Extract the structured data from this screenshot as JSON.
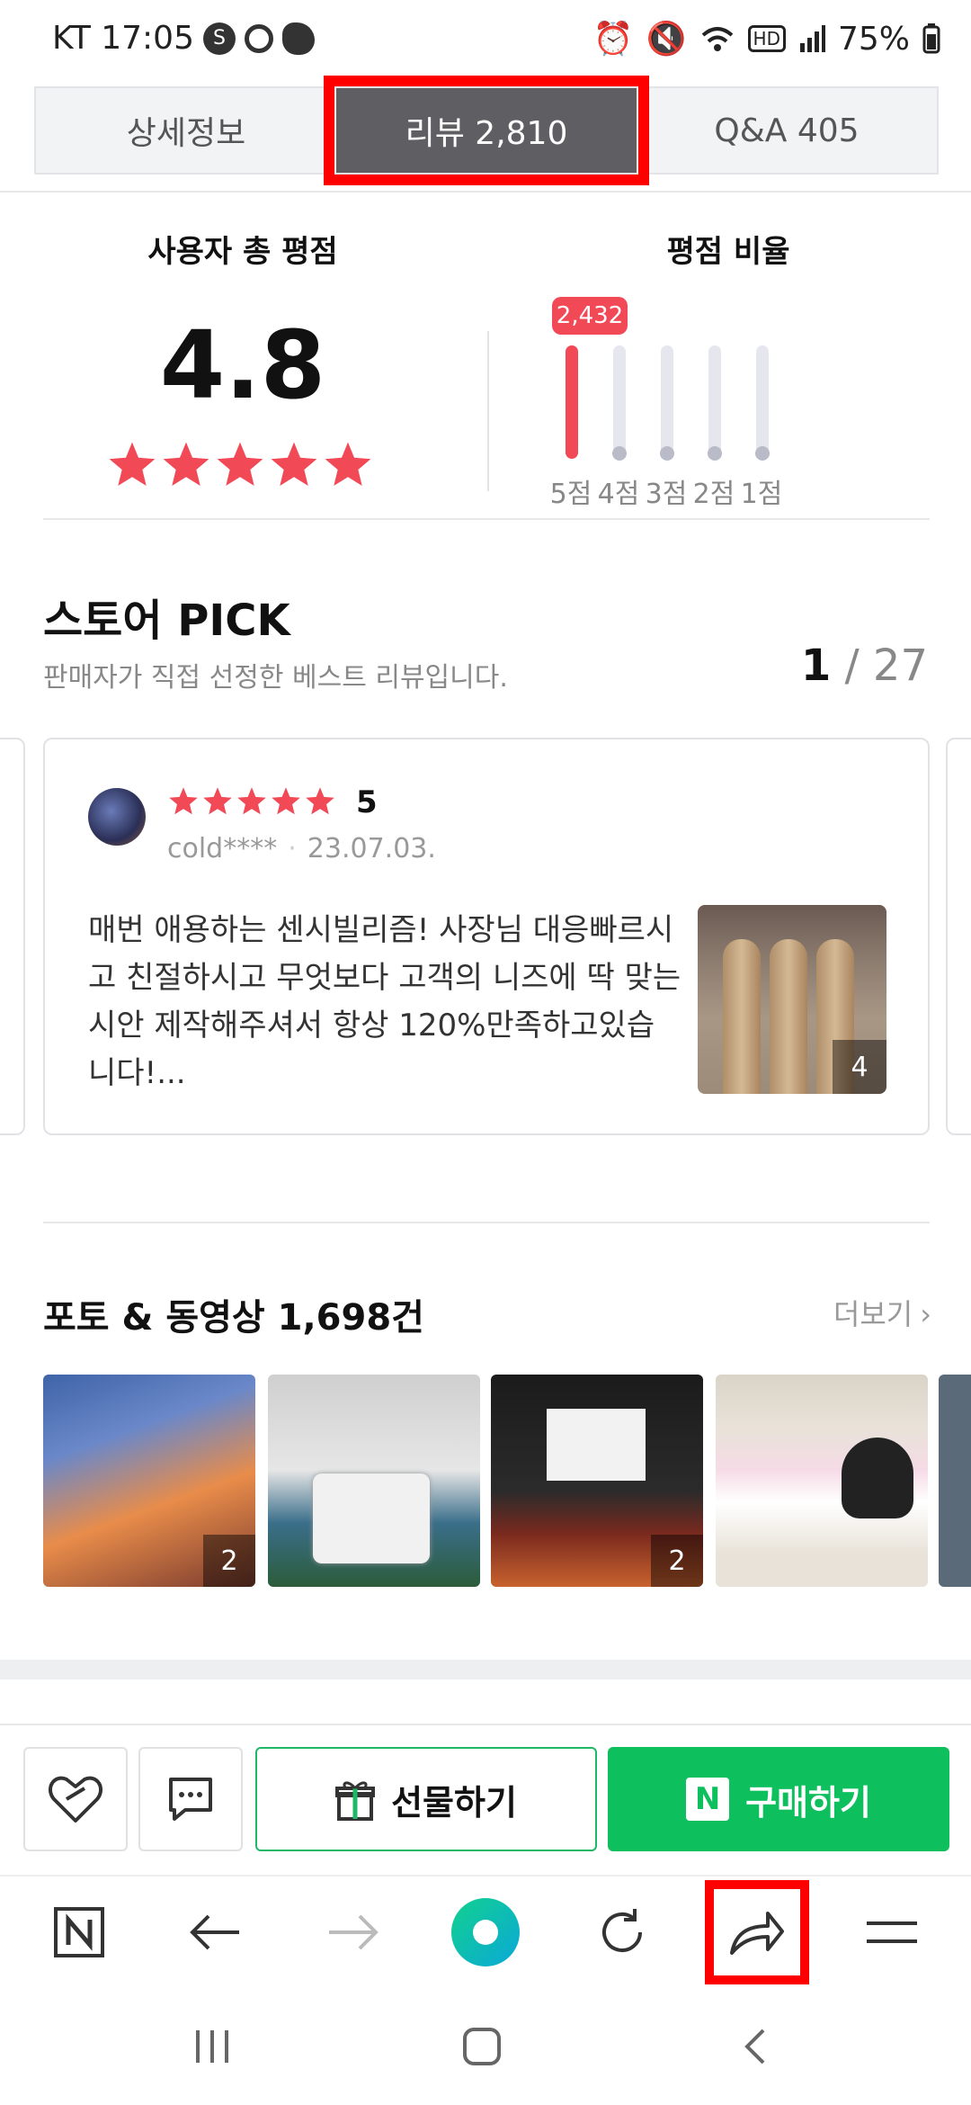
{
  "status_bar": {
    "carrier_time": "KT 17:05",
    "battery": "75%"
  },
  "tabs": [
    {
      "label": "상세정보"
    },
    {
      "label": "리뷰  2,810"
    },
    {
      "label": "Q&A  405"
    }
  ],
  "summary": {
    "total_title": "사용자 총 평점",
    "score": "4.8",
    "ratio_title": "평점 비율",
    "top_count": "2,432",
    "bars": [
      {
        "label": "5점",
        "fraction": 1.0
      },
      {
        "label": "4점",
        "fraction": 0.0
      },
      {
        "label": "3점",
        "fraction": 0.0
      },
      {
        "label": "2점",
        "fraction": 0.0
      },
      {
        "label": "1점",
        "fraction": 0.0
      }
    ]
  },
  "store_pick": {
    "title": "스토어 PICK",
    "subtitle": "판매자가 직접 선정한 베스트 리뷰입니다.",
    "page_current": "1",
    "page_sep": " / ",
    "page_total": "27",
    "review": {
      "score": "5",
      "user": "cold****",
      "date": "23.07.03.",
      "text": "매번 애용하는 센시빌리즘! 사장님 대응빠르시고 친절하시고 무엇보다 고객의 니즈에 딱 맞는 시안 제작해주셔서 항상 120%만족하고있습니다!...",
      "photo_count": "4"
    }
  },
  "photos": {
    "title": "포토 & 동영상 1,698건",
    "more": "더보기",
    "items": [
      {
        "count": "2"
      },
      {
        "count": ""
      },
      {
        "count": "2"
      },
      {
        "count": ""
      }
    ]
  },
  "actions": {
    "gift": "선물하기",
    "buy": "구매하기",
    "n_badge": "N"
  },
  "colors": {
    "accent_red": "#f24957",
    "naver_green": "#0dbf5d",
    "highlight_red": "#ff0000"
  }
}
